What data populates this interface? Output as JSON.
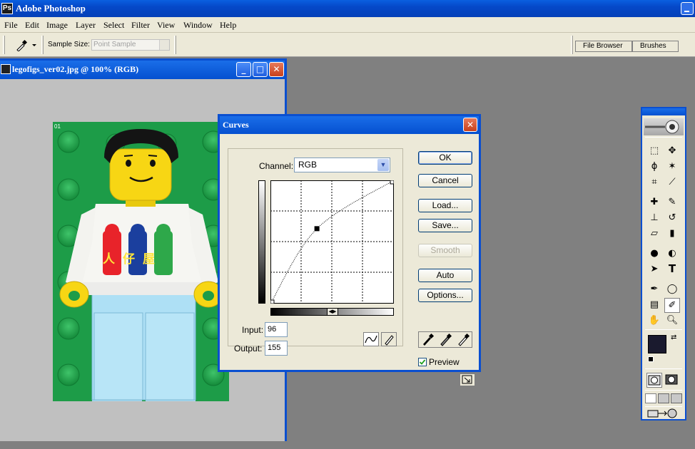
{
  "app": {
    "title": "Adobe Photoshop"
  },
  "menu": [
    "File",
    "Edit",
    "Image",
    "Layer",
    "Select",
    "Filter",
    "View",
    "Window",
    "Help"
  ],
  "options_bar": {
    "sample_size_label": "Sample Size:",
    "sample_size_value": "Point Sample",
    "palette_tabs": [
      "File Browser",
      "Brushes"
    ]
  },
  "document": {
    "title": "legofigs_ver02.jpg @ 100% (RGB)",
    "image_badge": "01",
    "shirt_text": [
      "人",
      "仔",
      "屋"
    ]
  },
  "curves": {
    "title": "Curves",
    "channel_label": "Channel:",
    "channel_value": "RGB",
    "input_label": "Input:",
    "input_value": "96",
    "output_label": "Output:",
    "output_value": "155",
    "buttons": {
      "ok": "OK",
      "cancel": "Cancel",
      "load": "Load...",
      "save": "Save...",
      "smooth": "Smooth",
      "auto": "Auto",
      "options": "Options..."
    },
    "preview_label": "Preview",
    "preview_checked": true,
    "curve_points": [
      [
        0,
        0
      ],
      [
        96,
        155
      ],
      [
        255,
        255
      ]
    ]
  },
  "toolbox": {
    "tools": [
      "marquee",
      "move",
      "lasso",
      "magic-wand",
      "crop",
      "slice",
      "healing",
      "brush",
      "stamp",
      "history-brush",
      "eraser",
      "gradient",
      "blur",
      "dodge",
      "path-select",
      "type",
      "pen",
      "shape",
      "notes",
      "eyedropper",
      "hand",
      "zoom"
    ],
    "foreground_color": "#1a1a2e",
    "background_color": "#9b2a5c"
  }
}
